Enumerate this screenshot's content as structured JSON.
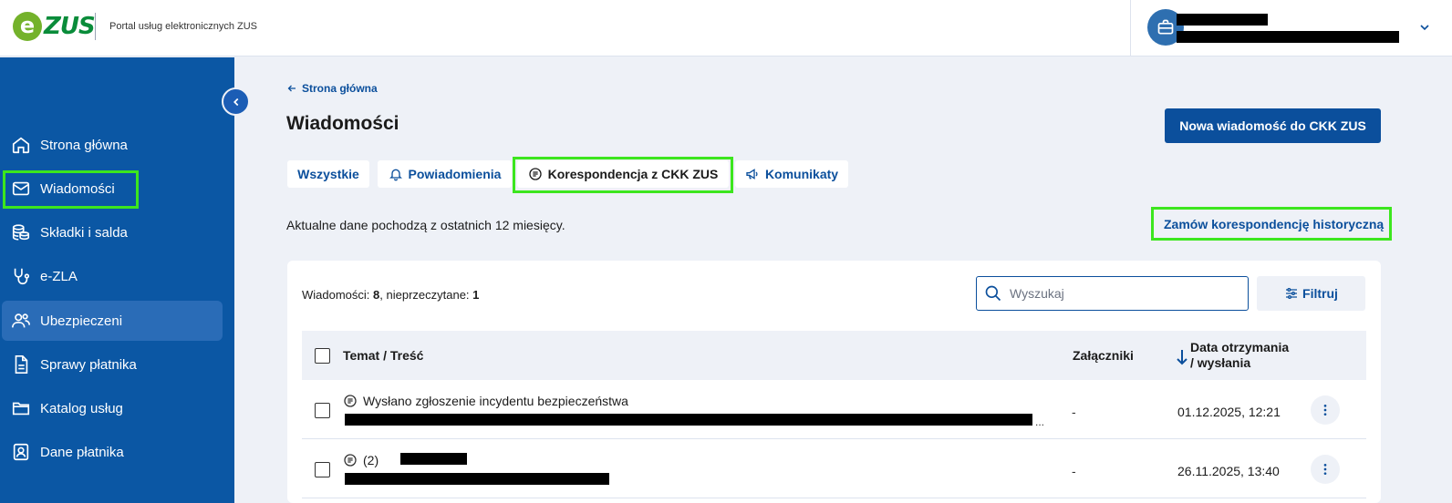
{
  "header": {
    "logo_e": "e",
    "logo_zus": "ZUS",
    "portal_title": "Portal usług elektronicznych ZUS"
  },
  "sidebar": {
    "items": [
      {
        "label": "Strona główna",
        "icon": "home-icon"
      },
      {
        "label": "Wiadomości",
        "icon": "mail-icon"
      },
      {
        "label": "Składki i salda",
        "icon": "coins-icon"
      },
      {
        "label": "e-ZLA",
        "icon": "stethoscope-icon"
      },
      {
        "label": "Ubezpieczeni",
        "icon": "users-icon"
      },
      {
        "label": "Sprawy płatnika",
        "icon": "document-icon"
      },
      {
        "label": "Katalog usług",
        "icon": "folder-icon"
      },
      {
        "label": "Dane płatnika",
        "icon": "id-card-icon"
      }
    ]
  },
  "main": {
    "back_link": "Strona główna",
    "page_title": "Wiadomości",
    "new_message_button": "Nowa wiadomość do CKK ZUS",
    "tabs": [
      {
        "label": "Wszystkie"
      },
      {
        "label": "Powiadomienia"
      },
      {
        "label": "Korespondencja z CKK ZUS"
      },
      {
        "label": "Komunikaty"
      }
    ],
    "info_text": "Aktualne dane pochodzą z ostatnich 12 miesięcy.",
    "history_link": "Zamów korespondencję historyczną",
    "counts": {
      "messages_label": "Wiadomości: ",
      "messages_value": "8",
      "unread_label": ", nieprzeczytane: ",
      "unread_value": "1"
    },
    "search": {
      "placeholder": "Wyszukaj"
    },
    "filter_button": "Filtruj",
    "table": {
      "col_subject": "Temat / Treść",
      "col_attachments": "Załączniki",
      "col_date_line1": "Data otrzymania",
      "col_date_line2": "/ wysłania",
      "rows": [
        {
          "subject": "Wysłano zgłoszenie incydentu bezpieczeństwa",
          "attachments": "-",
          "date": "01.12.2025, 12:21",
          "ellipsis": "..."
        },
        {
          "subject": "(2)",
          "attachments": "-",
          "date": "26.11.2025, 13:40"
        }
      ]
    }
  }
}
